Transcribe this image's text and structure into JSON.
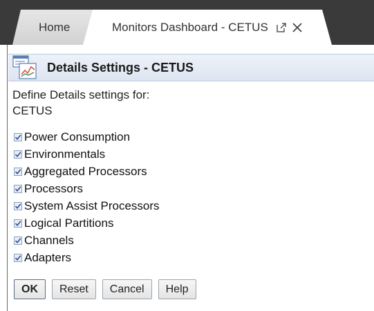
{
  "tabs": [
    {
      "label": "Home"
    },
    {
      "label": "Monitors Dashboard - CETUS"
    }
  ],
  "header": {
    "title": "Details Settings - CETUS",
    "icon": "details-settings-icon"
  },
  "define": {
    "line1": "Define Details settings for:",
    "line2": "CETUS"
  },
  "options": [
    {
      "label": "Power Consumption",
      "checked": true
    },
    {
      "label": "Environmentals",
      "checked": true
    },
    {
      "label": "Aggregated Processors",
      "checked": true
    },
    {
      "label": "Processors",
      "checked": true
    },
    {
      "label": "System Assist Processors",
      "checked": true
    },
    {
      "label": "Logical Partitions",
      "checked": true
    },
    {
      "label": "Channels",
      "checked": true
    },
    {
      "label": "Adapters",
      "checked": true
    }
  ],
  "buttons": {
    "ok": "OK",
    "reset": "Reset",
    "cancel": "Cancel",
    "help": "Help"
  },
  "colors": {
    "tabbar": "#3a3a3a",
    "header_bg": "#dde5f1",
    "check_mark": "#2a4f8f"
  }
}
